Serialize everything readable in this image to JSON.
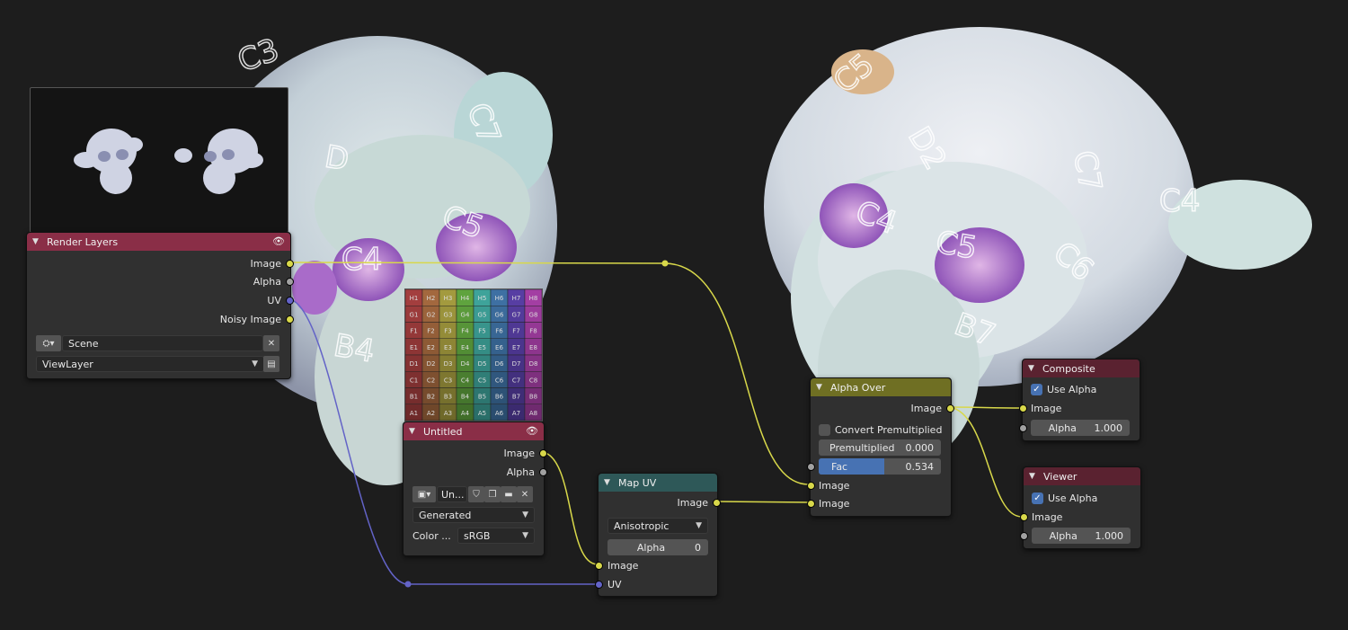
{
  "nodes": {
    "render_layers": {
      "title": "Render Layers",
      "outputs": [
        "Image",
        "Alpha",
        "UV",
        "Noisy Image"
      ],
      "scene_value": "Scene",
      "layer_value": "ViewLayer"
    },
    "untitled": {
      "title": "Untitled",
      "outputs": [
        "Image",
        "Alpha"
      ],
      "image_name": "Un...",
      "source": "Generated",
      "color_label": "Color ...",
      "color_space": "sRGB",
      "grid_labels": [
        [
          "H1",
          "H2",
          "H3",
          "H4",
          "H5",
          "H6",
          "H7",
          "H8"
        ],
        [
          "G1",
          "G2",
          "G3",
          "G4",
          "G5",
          "G6",
          "G7",
          "G8"
        ],
        [
          "F1",
          "F2",
          "F3",
          "F4",
          "F5",
          "F6",
          "F7",
          "F8"
        ],
        [
          "E1",
          "E2",
          "E3",
          "E4",
          "E5",
          "E6",
          "E7",
          "E8"
        ],
        [
          "D1",
          "D2",
          "D3",
          "D4",
          "D5",
          "D6",
          "D7",
          "D8"
        ],
        [
          "C1",
          "C2",
          "C3",
          "C4",
          "C5",
          "C6",
          "C7",
          "C8"
        ],
        [
          "B1",
          "B2",
          "B3",
          "B4",
          "B5",
          "B6",
          "B7",
          "B8"
        ],
        [
          "A1",
          "A2",
          "A3",
          "A4",
          "A5",
          "A6",
          "A7",
          "A8"
        ]
      ]
    },
    "map_uv": {
      "title": "Map UV",
      "output": "Image",
      "filter": "Anisotropic",
      "alpha_label": "Alpha",
      "alpha_value": "0",
      "inputs": [
        "Image",
        "UV"
      ]
    },
    "alpha_over": {
      "title": "Alpha Over",
      "output": "Image",
      "convert_label": "Convert Premultiplied",
      "premult_label": "Premultiplied",
      "premult_value": "0.000",
      "fac_label": "Fac",
      "fac_value": "0.534",
      "fac_fraction": 0.534,
      "inputs": [
        "Image",
        "Image"
      ]
    },
    "composite": {
      "title": "Composite",
      "use_alpha_label": "Use Alpha",
      "input": "Image",
      "alpha_label": "Alpha",
      "alpha_value": "1.000"
    },
    "viewer": {
      "title": "Viewer",
      "use_alpha_label": "Use Alpha",
      "input": "Image",
      "alpha_label": "Alpha",
      "alpha_value": "1.000"
    }
  },
  "backdrop_labels_left": [
    "C3",
    "C7",
    "D",
    "C4",
    "C5",
    "B4"
  ],
  "backdrop_labels_right": [
    "C5",
    "D2",
    "C7",
    "C4",
    "C5",
    "C6",
    "B7",
    "C4"
  ],
  "colors": {
    "input_header": "#8a2e47",
    "output_header": "#5a2230",
    "color_header": "#6f6f23",
    "vector_header": "#2e5858",
    "socket_color": "#d8d84a",
    "socket_vector": "#6363c7",
    "socket_float": "#a1a1a1",
    "accent": "#4772b3"
  }
}
